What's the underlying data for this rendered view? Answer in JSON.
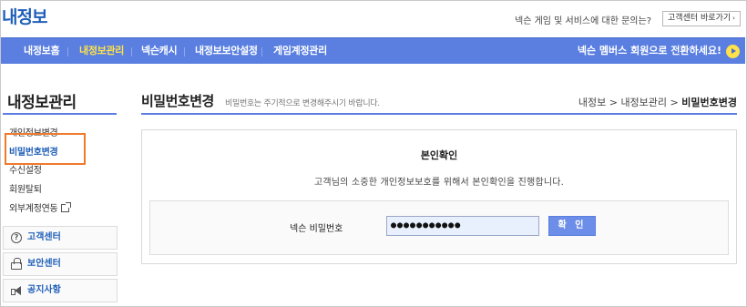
{
  "header": {
    "logo": "내정보",
    "help_text": "넥슨 게임 및 서비스에 대한 문의는?",
    "help_button": "고객센터 바로가기",
    "help_button_arrow": "›"
  },
  "nav": {
    "items": [
      "내정보홈",
      "내정보관리",
      "넥슨캐시",
      "내정보보안설정",
      "게임계정관리"
    ],
    "active": "내정보관리",
    "promo": "넥슨 멤버스 회원으로 전환하세요!"
  },
  "sidebar": {
    "title": "내정보관리",
    "links": [
      "개인정보변경",
      "비밀번호변경",
      "수신설정",
      "회원탈퇴",
      "외부계정연동"
    ],
    "active": "비밀번호변경",
    "boxes": [
      {
        "icon": "help-circle-icon",
        "label": "고객센터"
      },
      {
        "icon": "lock-icon",
        "label": "보안센터"
      },
      {
        "icon": "speaker-icon",
        "label": "공지사항"
      }
    ]
  },
  "main": {
    "title": "비밀번호변경",
    "subtitle": "비밀번호는 주기적으로 변경해주시기 바랍니다.",
    "breadcrumb": [
      "내정보",
      "내정보관리",
      "비밀번호변경"
    ],
    "breadcrumb_sep": ">",
    "panel_title": "본인확인",
    "panel_desc": "고객님의 소중한 개인정보보호를 위해서 본인확인을 진행합니다.",
    "password_label": "넥슨 비밀번호",
    "password_value": "●●●●●●●●●●●",
    "confirm_button": "확 인"
  },
  "colors": {
    "accent": "#5a7fe0",
    "active_nav": "#ffe24a",
    "highlight": "#f07a2c",
    "link_blue": "#1f5fb8"
  }
}
